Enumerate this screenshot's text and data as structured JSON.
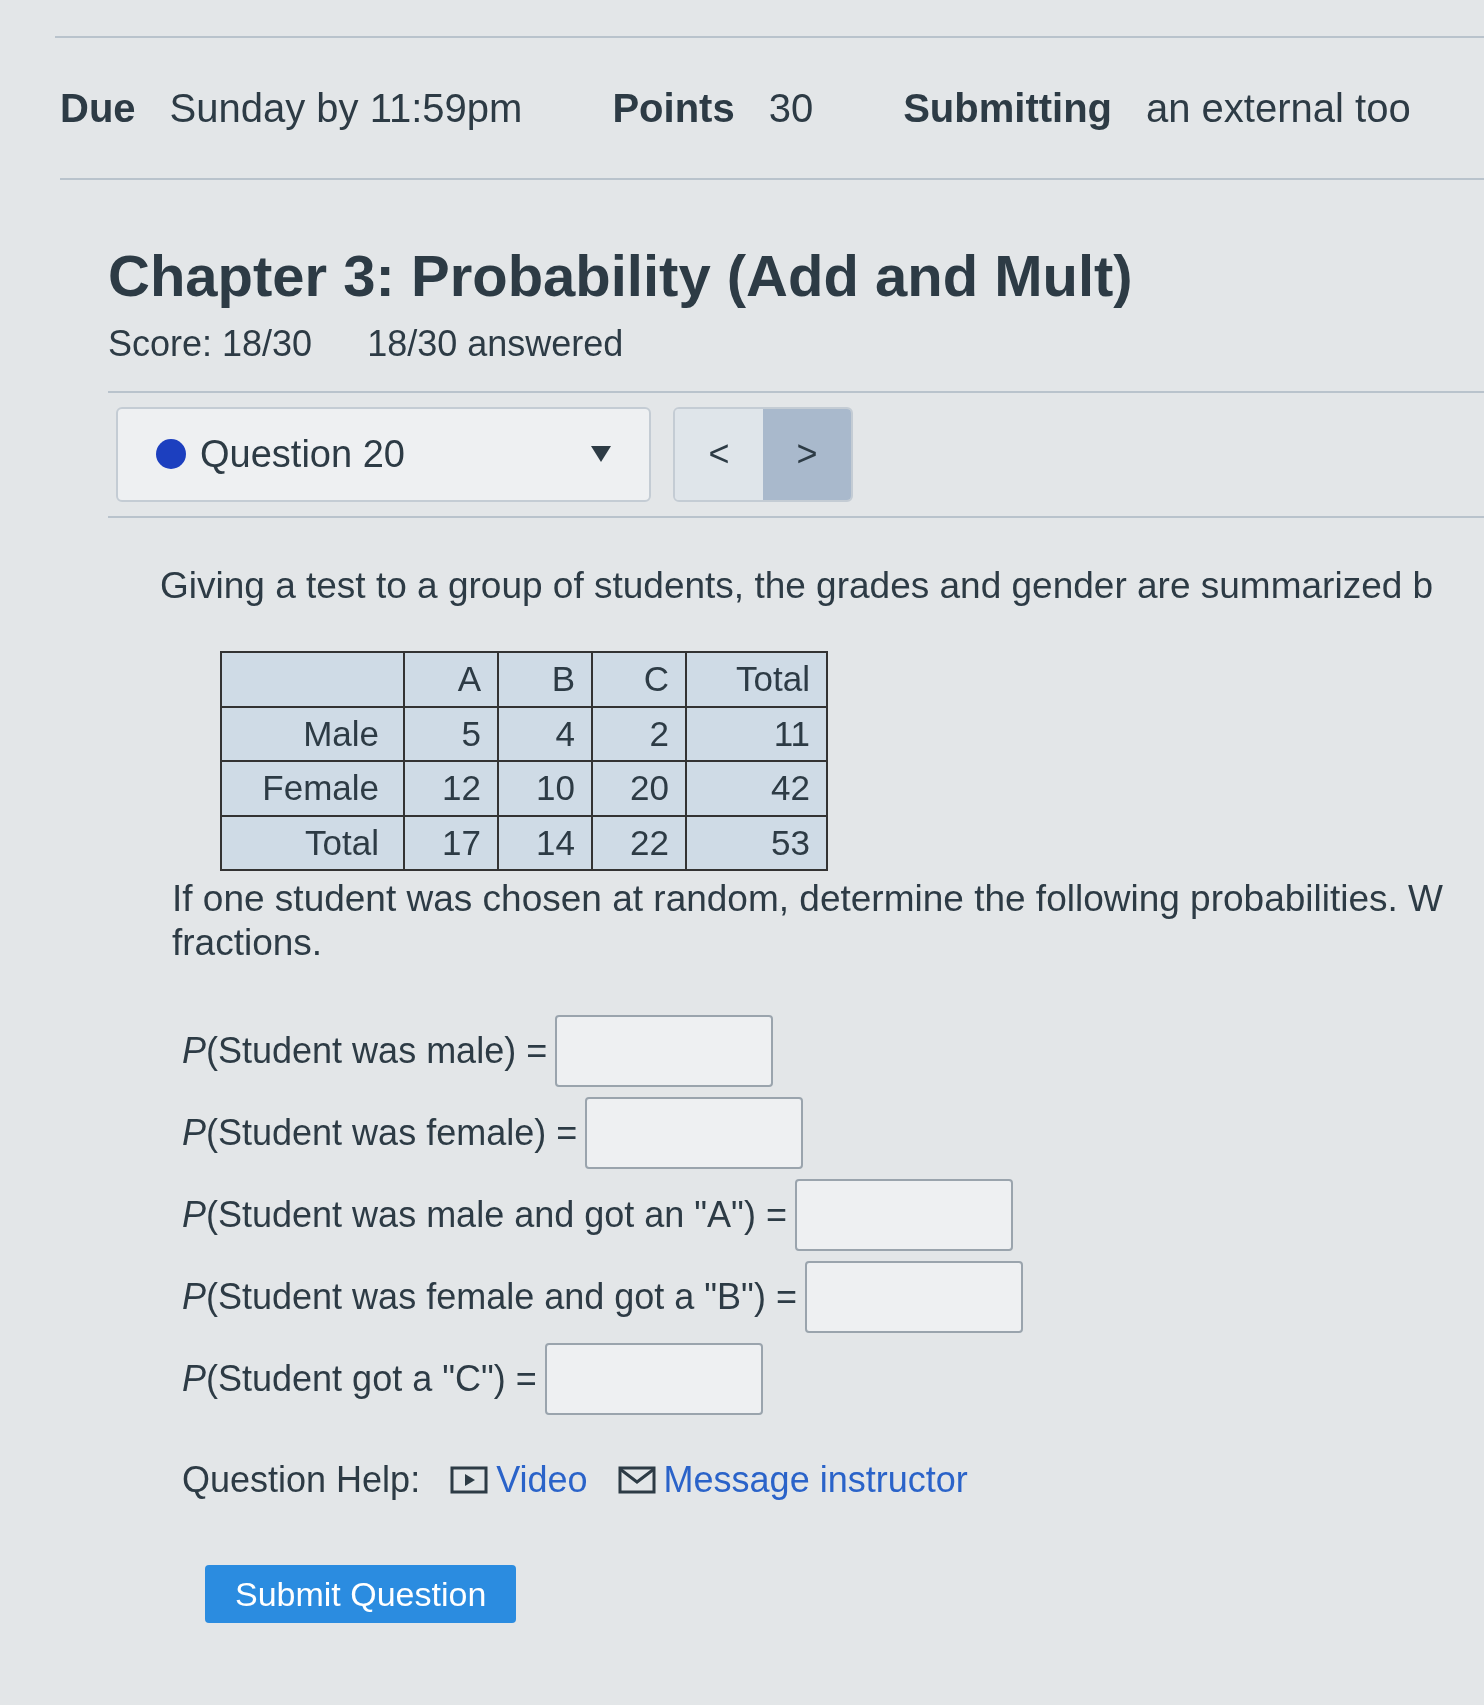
{
  "details": [
    {
      "label": "Due",
      "value": "Sunday by 11:59pm"
    },
    {
      "label": "Points",
      "value": "30"
    },
    {
      "label": "Submitting",
      "value": "an external too"
    }
  ],
  "title": "Chapter 3: Probability (Add and Mult)",
  "score": "Score: 18/30",
  "answered": "18/30 answered",
  "question_select": {
    "label": "Question 20",
    "color": "#1c3fbf"
  },
  "nav": [
    {
      "label": "<",
      "selected": false
    },
    {
      "label": ">",
      "selected": true
    }
  ],
  "prompt": "Giving a test to a group of students, the grades and gender are summarized b",
  "table": {
    "columns": [
      "A",
      "B",
      "C",
      "Total"
    ],
    "rows": [
      {
        "label": "Male",
        "cells": [
          "5",
          "4",
          "2",
          "11"
        ]
      },
      {
        "label": "Female",
        "cells": [
          "12",
          "10",
          "20",
          "42"
        ]
      },
      {
        "label": "Total",
        "cells": [
          "17",
          "14",
          "22",
          "53"
        ]
      }
    ]
  },
  "instruction": [
    "If one student was chosen at random, determine the following probabilities. W",
    "fractions."
  ],
  "answers": [
    {
      "label": "*P*(Student was male) ="
    },
    {
      "label": "*P*(Student was female) ="
    },
    {
      "label": "*P*(Student was male and got an \"A\") ="
    },
    {
      "label": "*P*(Student was female and got a \"B\") ="
    },
    {
      "label": "*P*(Student got a \"C\") ="
    }
  ],
  "help": {
    "label": "Question Help:",
    "links": [
      {
        "kind": "video",
        "text": "Video"
      },
      {
        "kind": "message",
        "text": "Message instructor"
      }
    ]
  },
  "submit": "Submit Question"
}
